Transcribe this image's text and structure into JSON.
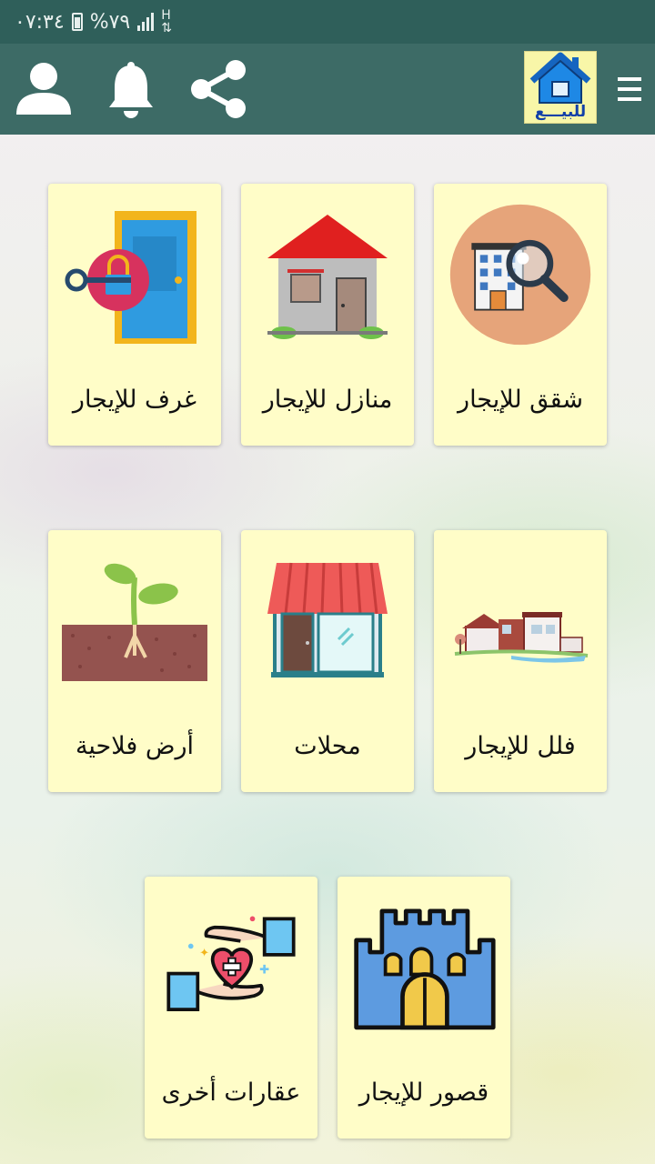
{
  "status": {
    "time": "٠٧:٣٤",
    "battery": "%٧٩"
  },
  "header": {
    "logo_text": "للبيـــع"
  },
  "colors": {
    "status_bar": "#2f5f5a",
    "app_bar": "#3d6b66",
    "card_bg": "#fffdc8"
  },
  "icons": {
    "menu": "hamburger-menu-icon",
    "share": "share-icon",
    "notifications": "bell-icon",
    "profile": "user-icon"
  },
  "categories": [
    {
      "label": "شقق للإيجار",
      "icon": "apartment-search-icon"
    },
    {
      "label": "منازل للإيجار",
      "icon": "house-icon"
    },
    {
      "label": "غرف للإيجار",
      "icon": "room-door-key-icon"
    },
    {
      "label": "فلل للإيجار",
      "icon": "villa-icon"
    },
    {
      "label": "محلات",
      "icon": "shop-icon"
    },
    {
      "label": "أرض فلاحية",
      "icon": "farmland-sprout-icon"
    },
    {
      "label": "قصور للإيجار",
      "icon": "castle-icon"
    },
    {
      "label": "عقارات أخرى",
      "icon": "other-properties-hands-icon"
    }
  ]
}
